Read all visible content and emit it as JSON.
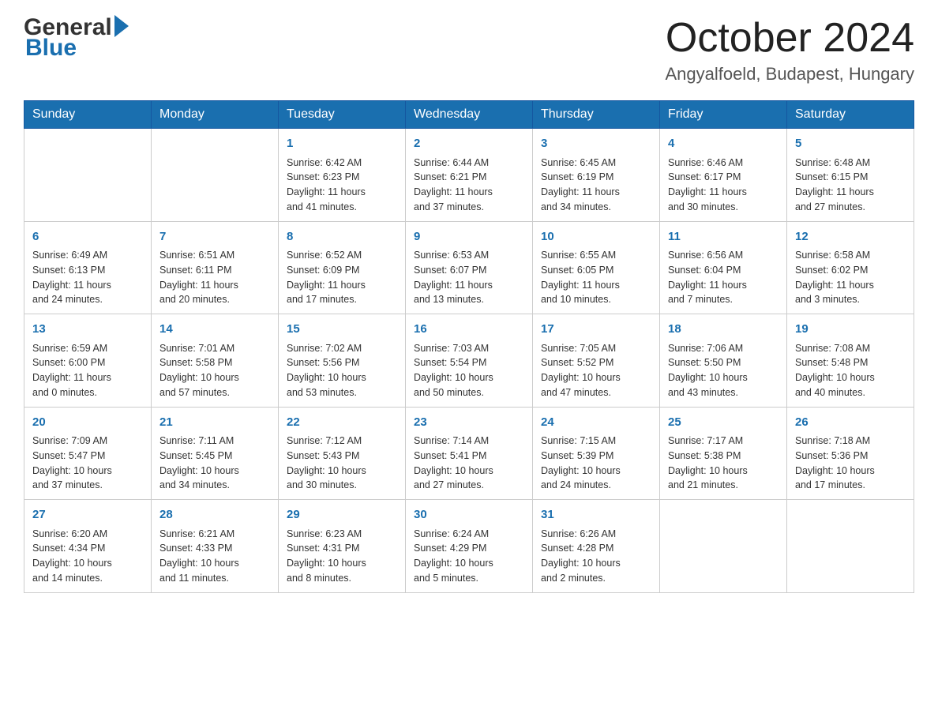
{
  "header": {
    "logo_general": "General",
    "logo_blue": "Blue",
    "month_title": "October 2024",
    "location": "Angyalfoeld, Budapest, Hungary"
  },
  "weekdays": [
    "Sunday",
    "Monday",
    "Tuesday",
    "Wednesday",
    "Thursday",
    "Friday",
    "Saturday"
  ],
  "weeks": [
    [
      {
        "day": "",
        "info": ""
      },
      {
        "day": "",
        "info": ""
      },
      {
        "day": "1",
        "info": "Sunrise: 6:42 AM\nSunset: 6:23 PM\nDaylight: 11 hours\nand 41 minutes."
      },
      {
        "day": "2",
        "info": "Sunrise: 6:44 AM\nSunset: 6:21 PM\nDaylight: 11 hours\nand 37 minutes."
      },
      {
        "day": "3",
        "info": "Sunrise: 6:45 AM\nSunset: 6:19 PM\nDaylight: 11 hours\nand 34 minutes."
      },
      {
        "day": "4",
        "info": "Sunrise: 6:46 AM\nSunset: 6:17 PM\nDaylight: 11 hours\nand 30 minutes."
      },
      {
        "day": "5",
        "info": "Sunrise: 6:48 AM\nSunset: 6:15 PM\nDaylight: 11 hours\nand 27 minutes."
      }
    ],
    [
      {
        "day": "6",
        "info": "Sunrise: 6:49 AM\nSunset: 6:13 PM\nDaylight: 11 hours\nand 24 minutes."
      },
      {
        "day": "7",
        "info": "Sunrise: 6:51 AM\nSunset: 6:11 PM\nDaylight: 11 hours\nand 20 minutes."
      },
      {
        "day": "8",
        "info": "Sunrise: 6:52 AM\nSunset: 6:09 PM\nDaylight: 11 hours\nand 17 minutes."
      },
      {
        "day": "9",
        "info": "Sunrise: 6:53 AM\nSunset: 6:07 PM\nDaylight: 11 hours\nand 13 minutes."
      },
      {
        "day": "10",
        "info": "Sunrise: 6:55 AM\nSunset: 6:05 PM\nDaylight: 11 hours\nand 10 minutes."
      },
      {
        "day": "11",
        "info": "Sunrise: 6:56 AM\nSunset: 6:04 PM\nDaylight: 11 hours\nand 7 minutes."
      },
      {
        "day": "12",
        "info": "Sunrise: 6:58 AM\nSunset: 6:02 PM\nDaylight: 11 hours\nand 3 minutes."
      }
    ],
    [
      {
        "day": "13",
        "info": "Sunrise: 6:59 AM\nSunset: 6:00 PM\nDaylight: 11 hours\nand 0 minutes."
      },
      {
        "day": "14",
        "info": "Sunrise: 7:01 AM\nSunset: 5:58 PM\nDaylight: 10 hours\nand 57 minutes."
      },
      {
        "day": "15",
        "info": "Sunrise: 7:02 AM\nSunset: 5:56 PM\nDaylight: 10 hours\nand 53 minutes."
      },
      {
        "day": "16",
        "info": "Sunrise: 7:03 AM\nSunset: 5:54 PM\nDaylight: 10 hours\nand 50 minutes."
      },
      {
        "day": "17",
        "info": "Sunrise: 7:05 AM\nSunset: 5:52 PM\nDaylight: 10 hours\nand 47 minutes."
      },
      {
        "day": "18",
        "info": "Sunrise: 7:06 AM\nSunset: 5:50 PM\nDaylight: 10 hours\nand 43 minutes."
      },
      {
        "day": "19",
        "info": "Sunrise: 7:08 AM\nSunset: 5:48 PM\nDaylight: 10 hours\nand 40 minutes."
      }
    ],
    [
      {
        "day": "20",
        "info": "Sunrise: 7:09 AM\nSunset: 5:47 PM\nDaylight: 10 hours\nand 37 minutes."
      },
      {
        "day": "21",
        "info": "Sunrise: 7:11 AM\nSunset: 5:45 PM\nDaylight: 10 hours\nand 34 minutes."
      },
      {
        "day": "22",
        "info": "Sunrise: 7:12 AM\nSunset: 5:43 PM\nDaylight: 10 hours\nand 30 minutes."
      },
      {
        "day": "23",
        "info": "Sunrise: 7:14 AM\nSunset: 5:41 PM\nDaylight: 10 hours\nand 27 minutes."
      },
      {
        "day": "24",
        "info": "Sunrise: 7:15 AM\nSunset: 5:39 PM\nDaylight: 10 hours\nand 24 minutes."
      },
      {
        "day": "25",
        "info": "Sunrise: 7:17 AM\nSunset: 5:38 PM\nDaylight: 10 hours\nand 21 minutes."
      },
      {
        "day": "26",
        "info": "Sunrise: 7:18 AM\nSunset: 5:36 PM\nDaylight: 10 hours\nand 17 minutes."
      }
    ],
    [
      {
        "day": "27",
        "info": "Sunrise: 6:20 AM\nSunset: 4:34 PM\nDaylight: 10 hours\nand 14 minutes."
      },
      {
        "day": "28",
        "info": "Sunrise: 6:21 AM\nSunset: 4:33 PM\nDaylight: 10 hours\nand 11 minutes."
      },
      {
        "day": "29",
        "info": "Sunrise: 6:23 AM\nSunset: 4:31 PM\nDaylight: 10 hours\nand 8 minutes."
      },
      {
        "day": "30",
        "info": "Sunrise: 6:24 AM\nSunset: 4:29 PM\nDaylight: 10 hours\nand 5 minutes."
      },
      {
        "day": "31",
        "info": "Sunrise: 6:26 AM\nSunset: 4:28 PM\nDaylight: 10 hours\nand 2 minutes."
      },
      {
        "day": "",
        "info": ""
      },
      {
        "day": "",
        "info": ""
      }
    ]
  ]
}
